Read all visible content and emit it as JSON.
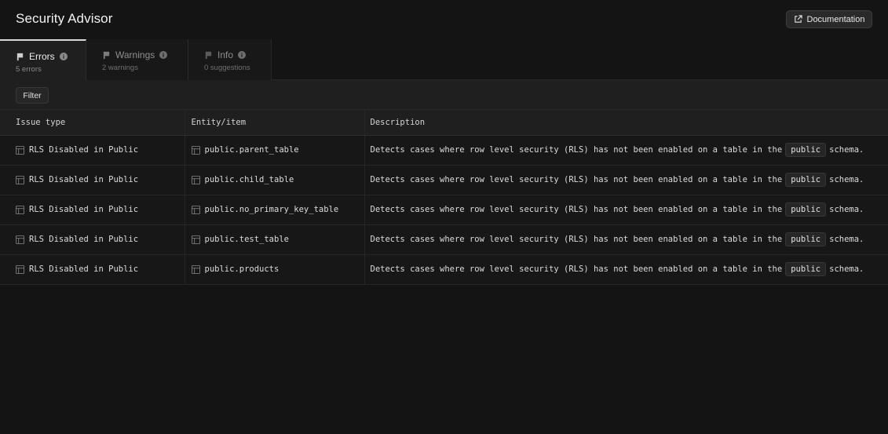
{
  "header": {
    "title": "Security Advisor",
    "documentation_label": "Documentation"
  },
  "tabs": [
    {
      "label": "Errors",
      "sub": "5 errors",
      "active": true
    },
    {
      "label": "Warnings",
      "sub": "2 warnings",
      "active": false
    },
    {
      "label": "Info",
      "sub": "0 suggestions",
      "active": false
    }
  ],
  "filter": {
    "label": "Filter"
  },
  "table": {
    "columns": [
      "Issue type",
      "Entity/item",
      "Description"
    ],
    "rows": [
      {
        "issue": "RLS Disabled in Public",
        "entity": "public.parent_table",
        "desc_pre": "Detects cases where row level security (RLS) has not been enabled on a table in the",
        "desc_code": "public",
        "desc_post": "schema."
      },
      {
        "issue": "RLS Disabled in Public",
        "entity": "public.child_table",
        "desc_pre": "Detects cases where row level security (RLS) has not been enabled on a table in the",
        "desc_code": "public",
        "desc_post": "schema."
      },
      {
        "issue": "RLS Disabled in Public",
        "entity": "public.no_primary_key_table",
        "desc_pre": "Detects cases where row level security (RLS) has not been enabled on a table in the",
        "desc_code": "public",
        "desc_post": "schema."
      },
      {
        "issue": "RLS Disabled in Public",
        "entity": "public.test_table",
        "desc_pre": "Detects cases where row level security (RLS) has not been enabled on a table in the",
        "desc_code": "public",
        "desc_post": "schema."
      },
      {
        "issue": "RLS Disabled in Public",
        "entity": "public.products",
        "desc_pre": "Detects cases where row level security (RLS) has not been enabled on a table in the",
        "desc_code": "public",
        "desc_post": "schema."
      }
    ]
  },
  "icons": {
    "documentation": "external-link-icon",
    "tab": "flag-icon",
    "tab_info": "info-circle-icon",
    "row": "table-icon"
  }
}
